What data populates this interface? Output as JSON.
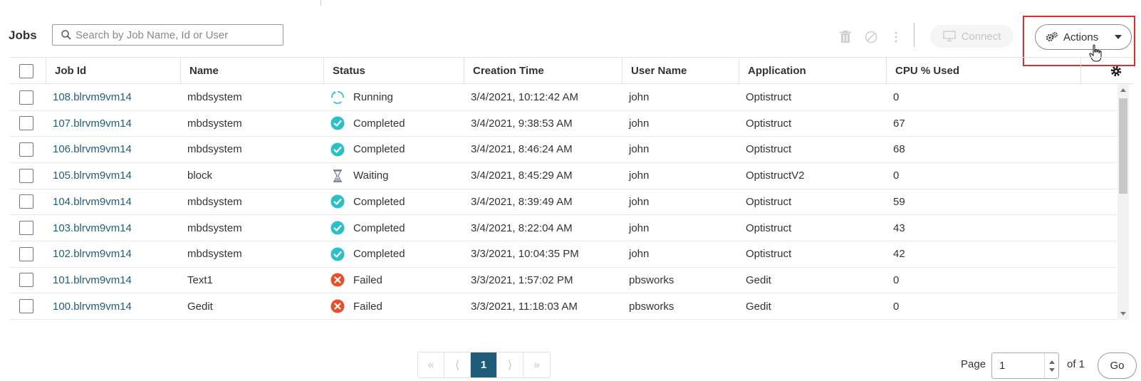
{
  "toolbar": {
    "title": "Jobs",
    "search_placeholder": "Search by Job Name, Id or User",
    "icons": [
      "trash-icon",
      "block-icon",
      "more-vertical-icon"
    ],
    "connect_label": "Connect",
    "actions_label": "Actions"
  },
  "table": {
    "columns": [
      "Job Id",
      "Name",
      "Status",
      "Creation Time",
      "User Name",
      "Application",
      "CPU % Used"
    ],
    "rows": [
      {
        "id": "108.blrvm9vm14",
        "name": "mbdsystem",
        "status": "Running",
        "created": "3/4/2021, 10:12:42 AM",
        "user": "john",
        "app": "Optistruct",
        "cpu": "0"
      },
      {
        "id": "107.blrvm9vm14",
        "name": "mbdsystem",
        "status": "Completed",
        "created": "3/4/2021, 9:38:53 AM",
        "user": "john",
        "app": "Optistruct",
        "cpu": "67"
      },
      {
        "id": "106.blrvm9vm14",
        "name": "mbdsystem",
        "status": "Completed",
        "created": "3/4/2021, 8:46:24 AM",
        "user": "john",
        "app": "Optistruct",
        "cpu": "68"
      },
      {
        "id": "105.blrvm9vm14",
        "name": "block",
        "status": "Waiting",
        "created": "3/4/2021, 8:45:29 AM",
        "user": "john",
        "app": "OptistructV2",
        "cpu": "0"
      },
      {
        "id": "104.blrvm9vm14",
        "name": "mbdsystem",
        "status": "Completed",
        "created": "3/4/2021, 8:39:49 AM",
        "user": "john",
        "app": "Optistruct",
        "cpu": "59"
      },
      {
        "id": "103.blrvm9vm14",
        "name": "mbdsystem",
        "status": "Completed",
        "created": "3/4/2021, 8:22:04 AM",
        "user": "john",
        "app": "Optistruct",
        "cpu": "43"
      },
      {
        "id": "102.blrvm9vm14",
        "name": "mbdsystem",
        "status": "Completed",
        "created": "3/3/2021, 10:04:35 PM",
        "user": "john",
        "app": "Optistruct",
        "cpu": "42"
      },
      {
        "id": "101.blrvm9vm14",
        "name": "Text1",
        "status": "Failed",
        "created": "3/3/2021, 1:57:02 PM",
        "user": "pbsworks",
        "app": "Gedit",
        "cpu": "0"
      },
      {
        "id": "100.blrvm9vm14",
        "name": "Gedit",
        "status": "Failed",
        "created": "3/3/2021, 11:18:03 AM",
        "user": "pbsworks",
        "app": "Gedit",
        "cpu": "0"
      }
    ]
  },
  "status_colors": {
    "Running": "#3bbfd6",
    "Completed": "#2bbfc6",
    "Waiting": "#7d8a99",
    "Failed": "#e8502a"
  },
  "pagination": {
    "first": "«",
    "prev": "⟨",
    "current": "1",
    "next": "⟩",
    "last": "»",
    "page_label": "Page",
    "page_value": "1",
    "of_label": "of 1",
    "go_label": "Go"
  },
  "colors": {
    "link": "#1f5d7a",
    "accent": "#1d5d79",
    "highlight": "#d9302f"
  }
}
